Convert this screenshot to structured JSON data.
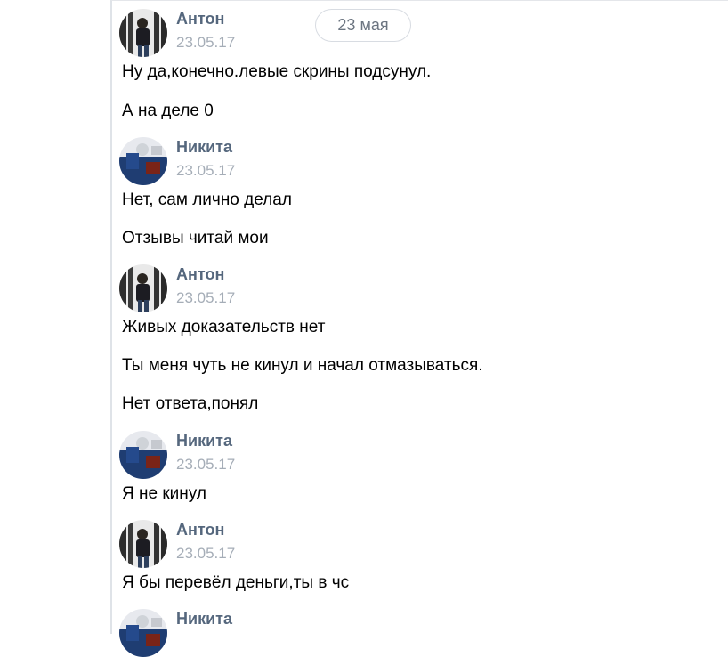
{
  "chat": {
    "date_separator": "23 мая",
    "messages": [
      {
        "author": "Антон",
        "date": "23.05.17",
        "avatar_icon": "user-photo-anton",
        "lines": [
          "Ну да,конечно.левые скрины подсунул.",
          "А на деле 0"
        ]
      },
      {
        "author": "Никита",
        "date": "23.05.17",
        "avatar_icon": "user-photo-nikita",
        "lines": [
          "Нет, сам лично делал",
          "Отзывы читай мои"
        ]
      },
      {
        "author": "Антон",
        "date": "23.05.17",
        "avatar_icon": "user-photo-anton",
        "lines": [
          "Живых доказательств нет",
          "Ты меня чуть не кинул и начал отмазываться.",
          "Нет ответа,понял"
        ]
      },
      {
        "author": "Никита",
        "date": "23.05.17",
        "avatar_icon": "user-photo-nikita",
        "lines": [
          "Я не кинул"
        ]
      },
      {
        "author": "Антон",
        "date": "23.05.17",
        "avatar_icon": "user-photo-anton",
        "lines": [
          "Я бы перевёл деньги,ты в чс"
        ]
      },
      {
        "author": "Никита",
        "avatar_icon": "user-photo-nikita",
        "lines": []
      }
    ]
  },
  "colors": {
    "author_name": "#55677d",
    "date": "#a5adb7",
    "date_pill_text": "#6c7581",
    "panel_border": "#dfe3e8"
  }
}
